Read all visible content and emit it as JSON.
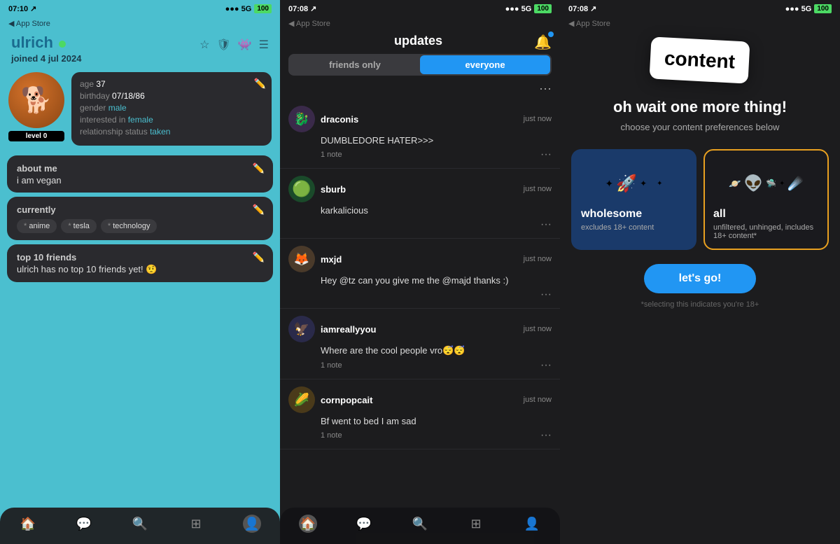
{
  "panel1": {
    "statusBar": {
      "time": "07:10",
      "arrow": "↑",
      "appStore": "◀ App Store",
      "signal": "●●● 5G",
      "battery": "100"
    },
    "username": "ulrich",
    "onlineStatus": "online",
    "joinedDate": "joined 4 jul 2024",
    "profileInfo": {
      "age": "37",
      "birthday": "07/18/86",
      "gender": "male",
      "interestedIn": "female",
      "relationshipStatus": "taken"
    },
    "levelBadge": "level 0",
    "aboutMe": {
      "title": "about me",
      "content": "i am vegan"
    },
    "currently": {
      "title": "currently",
      "tags": [
        "anime",
        "tesla",
        "technology"
      ]
    },
    "top10Friends": {
      "title": "top 10 friends",
      "emptyMsg": "ulrich has no top 10 friends yet! 🤨"
    },
    "nav": {
      "items": [
        "🏠",
        "💬",
        "🔍",
        "⊞",
        "👤"
      ]
    }
  },
  "panel2": {
    "statusBar": {
      "time": "07:08",
      "arrow": "↑",
      "appStore": "◀ App Store",
      "signal": "●●● 5G",
      "battery": "100"
    },
    "title": "updates",
    "tabs": {
      "friendsOnly": "friends only",
      "everyone": "everyone",
      "activeTab": "everyone"
    },
    "updates": [
      {
        "user": "draconis",
        "time": "just now",
        "content": "DUMBLEDORE HATER>>>",
        "noteCount": "1 note",
        "avatarEmoji": "🐉",
        "avatarBg": "#3a2a4a"
      },
      {
        "user": "sburb",
        "time": "just now",
        "content": "karkalicious",
        "noteCount": "",
        "avatarEmoji": "🟢",
        "avatarBg": "#2a4a2a"
      },
      {
        "user": "mxjd",
        "time": "just now",
        "content": "Hey @tz can you give me the @majd thanks :)",
        "noteCount": "",
        "avatarEmoji": "🦊",
        "avatarBg": "#4a3a2a"
      },
      {
        "user": "iamreallyyou",
        "time": "just now",
        "content": "Where are the cool people vro😴😴",
        "noteCount": "1 note",
        "avatarEmoji": "🦅",
        "avatarBg": "#2a2a4a"
      },
      {
        "user": "cornpopcait",
        "time": "just now",
        "content": "Bf went to bed I am sad",
        "noteCount": "1 note",
        "avatarEmoji": "🌽",
        "avatarBg": "#4a3a1a"
      }
    ]
  },
  "panel3": {
    "statusBar": {
      "time": "07:08",
      "arrow": "↑",
      "appStore": "◀ App Store",
      "signal": "●●● 5G",
      "battery": "100"
    },
    "contentCard": "content",
    "headline": "oh wait one more thing!",
    "subtext": "choose your content preferences below",
    "options": {
      "wholesome": {
        "title": "wholesome",
        "desc": "excludes 18+ content",
        "icon": "🚀"
      },
      "all": {
        "title": "all",
        "desc": "unfiltered, unhinged, includes 18+ content*",
        "icon": "👽"
      }
    },
    "letsGoBtn": "let's go!",
    "disclaimer": "*selecting this indicates you're 18+"
  }
}
